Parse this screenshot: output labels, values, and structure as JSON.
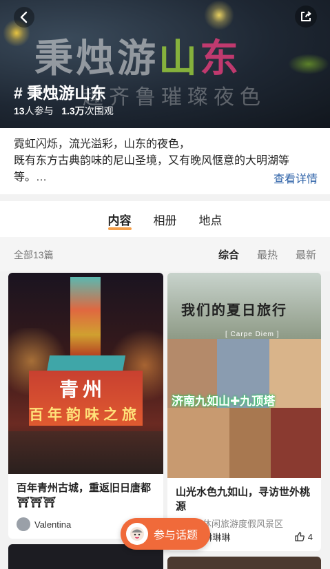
{
  "hero": {
    "art_title": "秉烛游山东",
    "art_subtitle": "趣齐鲁璀璨夜色",
    "topic_title": "# 秉烛游山东",
    "participants": "13",
    "participants_label": "人参与",
    "views": "1.3万",
    "views_label": "次围观"
  },
  "description": {
    "line1": "霓虹闪烁，流光溢彩，山东的夜色，",
    "line2": "既有东方古典韵味的尼山圣境，又有晚风惬意的大明湖等等。…",
    "more_label": "查看详情"
  },
  "tabs": [
    {
      "label": "内容",
      "active": true
    },
    {
      "label": "相册",
      "active": false
    },
    {
      "label": "地点",
      "active": false
    }
  ],
  "filter": {
    "count_label": "全部13篇",
    "options": [
      {
        "label": "综合",
        "active": true
      },
      {
        "label": "最热",
        "active": false
      },
      {
        "label": "最新",
        "active": false
      }
    ]
  },
  "cards": [
    {
      "image_text_1": "青州",
      "image_text_2": "百年韵味之旅",
      "title": "百年青州古城，重返旧日唐都⛩⛩⛩",
      "author": "Valentina"
    },
    {
      "image_title": "我们的夏日旅行",
      "image_sub": "[ Carpe Diem ]",
      "image_label": "济南九如山✚九顶塔",
      "title": "山光水色九如山，寻访世外桃源",
      "location": "九如山休闲旅游度假风景区",
      "author": "en琳琳琳",
      "likes": "4"
    }
  ],
  "join_button": {
    "label": "参与话题"
  },
  "colors": {
    "accent": "#f06a3a",
    "link": "#2f63a8",
    "tab_underline": "#f6a04b"
  }
}
